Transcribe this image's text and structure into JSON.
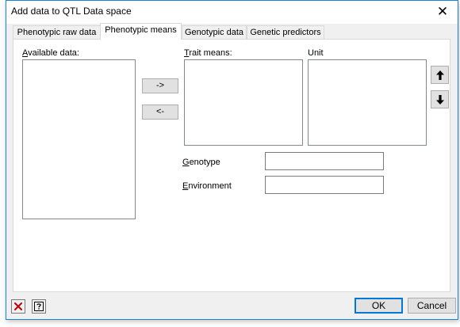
{
  "window": {
    "title": "Add data to QTL Data space",
    "close_glyph": "✕"
  },
  "tabs": [
    {
      "label": "Phenotypic raw data",
      "active": false
    },
    {
      "label": "Phenotypic means",
      "active": true
    },
    {
      "label": "Genotypic data",
      "active": false
    },
    {
      "label": "Genetic predictors",
      "active": false
    }
  ],
  "panel": {
    "available_data_label": "Available data:",
    "trait_means_label": "Trait means:",
    "unit_label": "Unit",
    "add_button": "->",
    "remove_button": "<-",
    "genotype_label": "Genotype",
    "genotype_value": "",
    "environment_label": "Environment",
    "environment_value": "",
    "move_up_icon": "arrow-up-icon",
    "move_down_icon": "arrow-down-icon"
  },
  "footer": {
    "clear_icon": "red-x-icon",
    "help_icon": "question-mark-icon",
    "ok_label": "OK",
    "cancel_label": "Cancel"
  },
  "colors": {
    "window_border": "#1883d7",
    "ok_border": "#0078d7",
    "clear_icon_red": "#c00000"
  }
}
